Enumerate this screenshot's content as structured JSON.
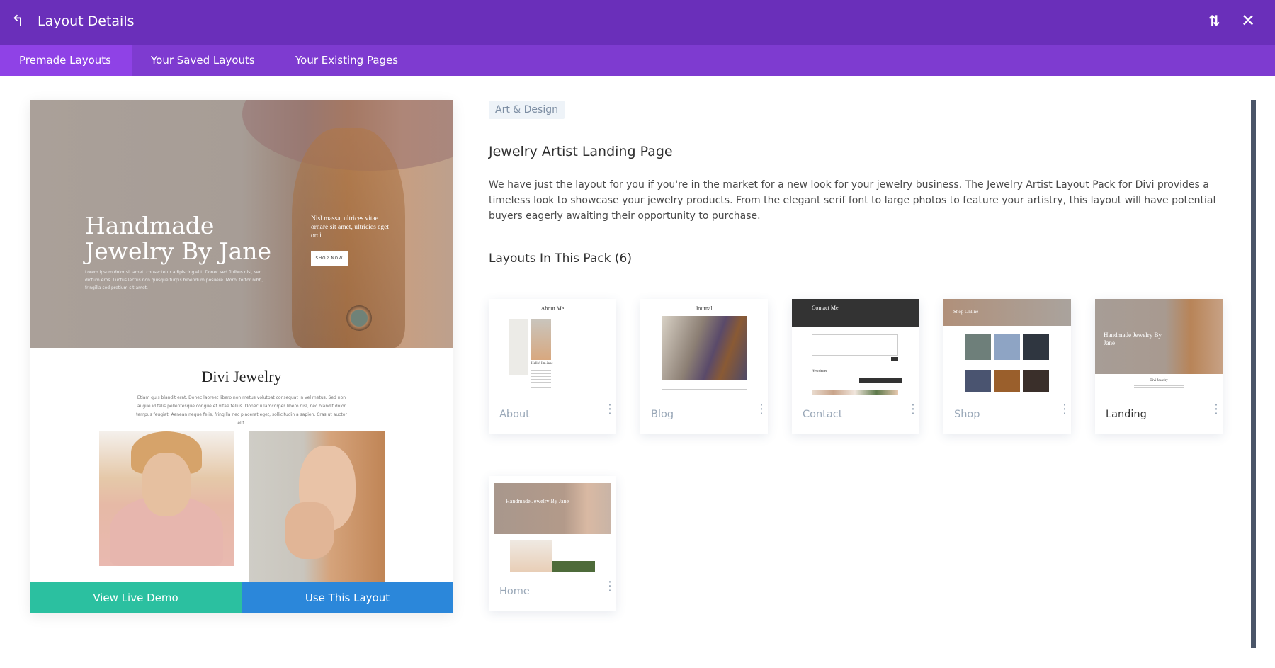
{
  "header": {
    "title": "Layout Details",
    "back_icon": "back-arrow-icon",
    "sort_icon": "sort-arrows-icon",
    "close_icon": "close-icon",
    "color": "#6a2fba"
  },
  "tabs": [
    {
      "label": "Premade Layouts",
      "active": true
    },
    {
      "label": "Your Saved Layouts",
      "active": false
    },
    {
      "label": "Your Existing Pages",
      "active": false
    }
  ],
  "preview": {
    "hero_title": "Handmade Jewelry By Jane",
    "hero_text": "Lorem ipsum dolor sit amet, consectetur adipiscing elit. Donec sed finibus nisi, sed dictum eros. Luctus lectus non quisque turpis bibendum posuere. Morbi tortor nibh, fringilla sed pretium sit amet.",
    "hero_side_text": "Nisl massa, ultrices vitae ornare sit amet, ultricies eget orci",
    "shop_now": "SHOP NOW",
    "section_title": "Divi Jewelry",
    "section_text": "Etiam quis blandit erat. Donec laoreet libero non metus volutpat consequat in vel metus. Sed non augue id felis pellentesque congue et vitae tellus. Donec ullamcorper libero nisl, nec blandit dolor tempus feugiat. Aenean neque felis, fringilla nec placerat eget, sollicitudin a sapien. Cras ut auctor elit.",
    "view_demo": "View Live Demo",
    "use_layout": "Use This Layout",
    "demo_color": "#2bc0a0",
    "use_color": "#2b87da"
  },
  "details": {
    "category": "Art & Design",
    "title": "Jewelry Artist Landing Page",
    "description": "We have just the layout for you if you're in the market for a new look for your jewelry business. The Jewelry Artist Layout Pack for Divi provides a timeless look to showcase your jewelry products. From the elegant serif font to large photos to feature your artistry, this layout will have potential buyers eagerly awaiting their opportunity to purchase.",
    "pack_title": "Layouts In This Pack (6)"
  },
  "layouts": [
    {
      "label": "About",
      "thumb_title": "About Me",
      "thumb_sub": "Hello! I'm Jane",
      "active": false
    },
    {
      "label": "Blog",
      "thumb_title": "Journal",
      "active": false
    },
    {
      "label": "Contact",
      "thumb_title": "Contact Me",
      "thumb_sub": "Newsletter",
      "active": false
    },
    {
      "label": "Shop",
      "thumb_title": "Shop Online",
      "active": false
    },
    {
      "label": "Landing",
      "thumb_title": "Handmade Jewelry By Jane",
      "thumb_sub": "Divi Jewelry",
      "active": true
    },
    {
      "label": "Home",
      "thumb_title": "Handmade Jewelry By Jane",
      "active": false
    }
  ],
  "menu_icon": "vertical-dots-icon"
}
